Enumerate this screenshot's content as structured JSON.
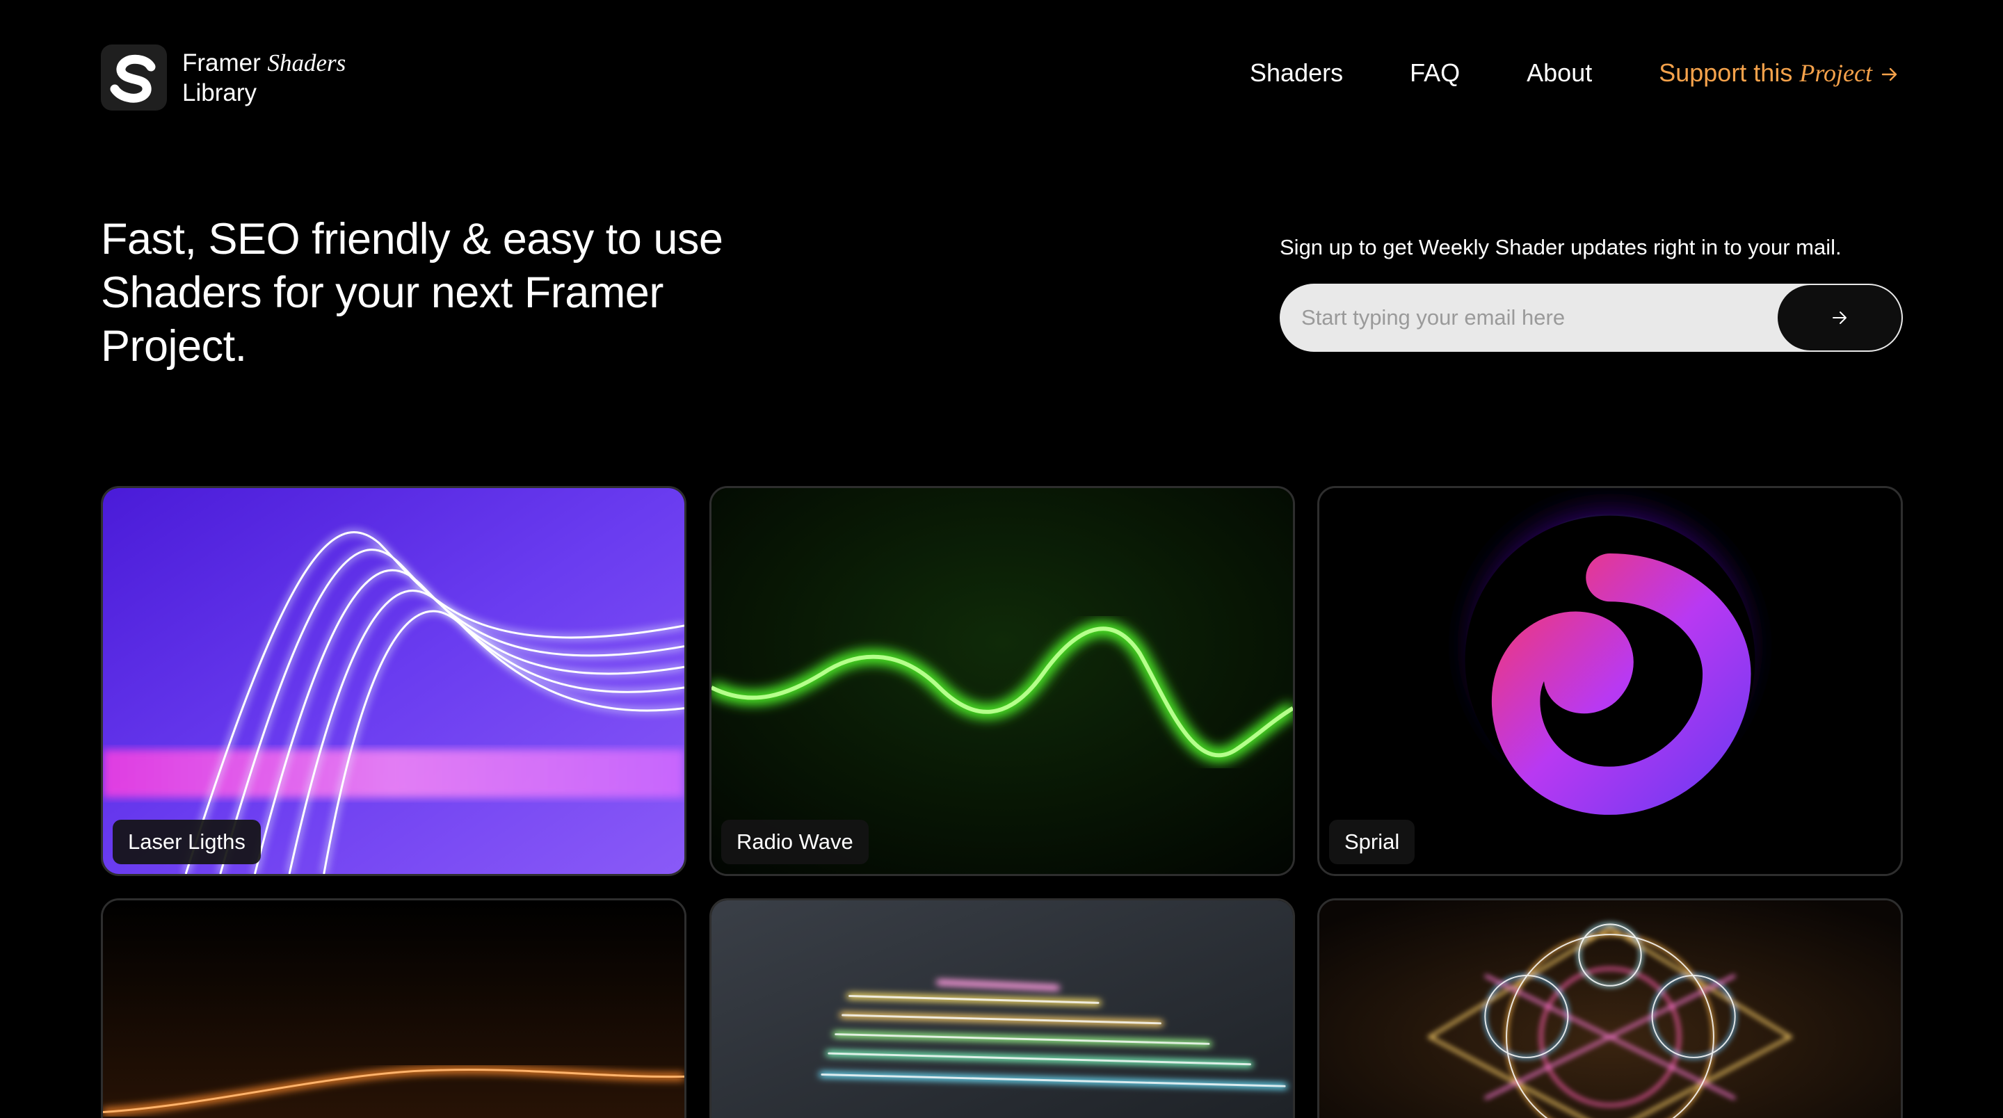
{
  "brand": {
    "name_line1": "Framer",
    "name_line1_italic": "Shaders",
    "name_line2": "Library",
    "logo_icon": "s-logo-icon"
  },
  "nav": {
    "items": [
      {
        "label": "Shaders"
      },
      {
        "label": "FAQ"
      },
      {
        "label": "About"
      }
    ],
    "support": {
      "label": "Support this",
      "label_italic": "Project",
      "icon": "arrow-right-icon"
    },
    "accent_color": "#f5a24b"
  },
  "hero": {
    "title": "Fast, SEO friendly & easy to use Shaders for your next Framer Project."
  },
  "signup": {
    "label": "Sign up to get Weekly Shader updates right in to your mail.",
    "placeholder": "Start typing your email here",
    "value": "",
    "submit_icon": "arrow-right-icon"
  },
  "shaders": [
    {
      "label": "Laser Ligths",
      "icon": "laser-lights-preview"
    },
    {
      "label": "Radio Wave",
      "icon": "radio-wave-preview"
    },
    {
      "label": "Sprial",
      "icon": "spiral-preview"
    },
    {
      "label": "",
      "icon": "orange-line-preview"
    },
    {
      "label": "",
      "icon": "rainbow-stairs-preview"
    },
    {
      "label": "",
      "icon": "kaleidoscope-preview"
    }
  ]
}
